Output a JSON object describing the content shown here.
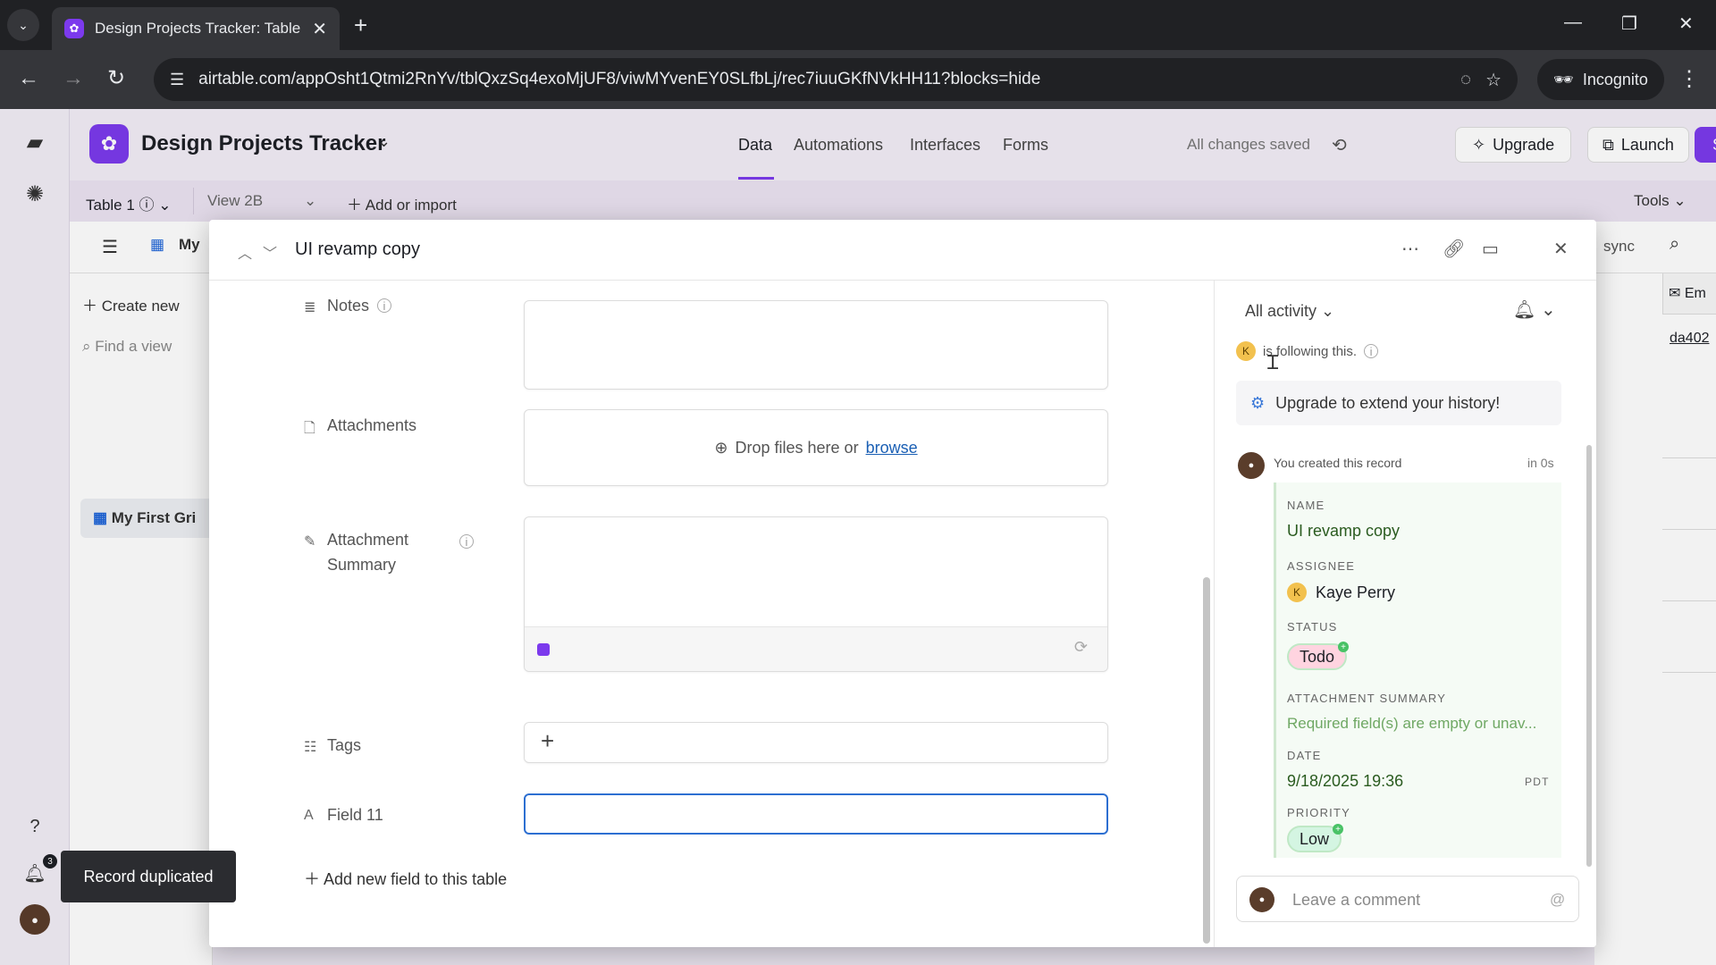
{
  "browser": {
    "tab_title": "Design Projects Tracker: Table",
    "url": "airtable.com/appOsht1Qtmi2RnYv/tblQxzSq4exoMjUF8/viwMYvenEY0SLfbLj/rec7iuuGKfNVkHH11?blocks=hide",
    "incognito_label": "Incognito"
  },
  "app": {
    "base_name": "Design Projects Tracker",
    "nav": [
      "Data",
      "Automations",
      "Interfaces",
      "Forms"
    ],
    "save_status": "All changes saved",
    "upgrade_label": "Upgrade",
    "launch_label": "Launch",
    "share_label": "Share",
    "accent_color": "#7c3aed"
  },
  "tablebar": {
    "table_name": "Table 1",
    "view_name": "View 2B",
    "add_import": "Add or import",
    "tools": "Tools"
  },
  "viewbar": {
    "view_prefix": "My",
    "sync": "sync"
  },
  "sidebar": {
    "create_new": "Create new",
    "find_view": "Find a view",
    "active_view": "My First Gri"
  },
  "grid": {
    "col_header": "Em",
    "cell_value": "da402"
  },
  "record": {
    "title": "UI revamp copy",
    "fields": {
      "notes_label": "Notes",
      "attachments_label": "Attachments",
      "drop_text": "Drop files here or",
      "browse_link": "browse",
      "summary_label_line1": "Attachment",
      "summary_label_line2": "Summary",
      "tags_label": "Tags",
      "field11_label": "Field 11",
      "field11_value": ""
    },
    "add_field": "Add new field to this table"
  },
  "activity": {
    "filter": "All activity",
    "follower_initial": "K",
    "follow_text": "is following this.",
    "upgrade_text": "Upgrade to extend your history!",
    "event_text": "You created this record",
    "event_time": "in 0s",
    "entries": {
      "name_key": "NAME",
      "name_val": "UI revamp copy",
      "assignee_key": "ASSIGNEE",
      "assignee_initial": "K",
      "assignee_val": "Kaye Perry",
      "status_key": "STATUS",
      "status_val": "Todo",
      "summary_key": "ATTACHMENT SUMMARY",
      "summary_val": "Required field(s) are empty or unav...",
      "date_key": "DATE",
      "date_val": "9/18/2025  19:36",
      "date_tz": "PDT",
      "priority_key": "PRIORITY",
      "priority_val": "Low"
    },
    "comment_placeholder": "Leave a comment"
  },
  "toast": "Record duplicated",
  "notification_count": "3"
}
